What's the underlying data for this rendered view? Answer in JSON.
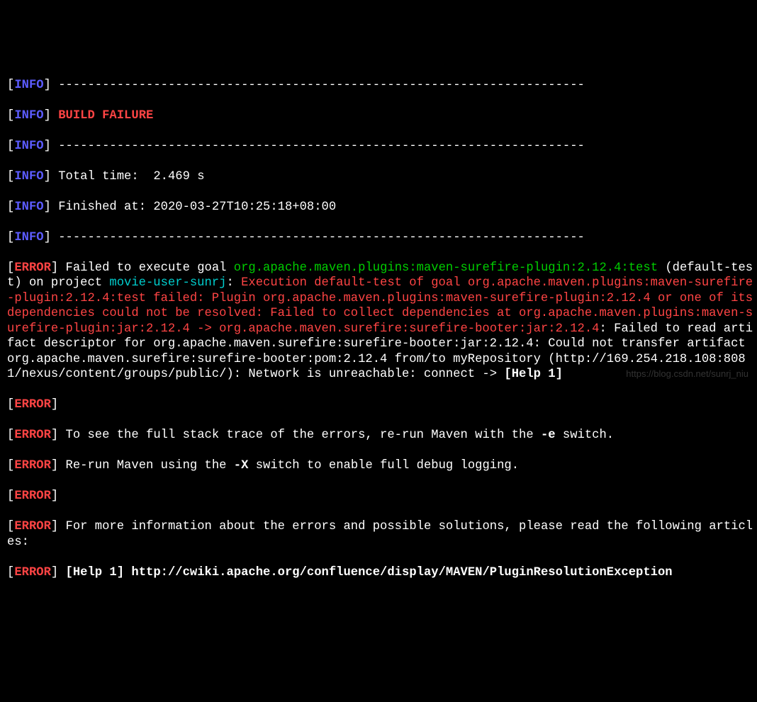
{
  "separator": "------------------------------------------------------------------------",
  "info_label": "INFO",
  "error_label": "ERROR",
  "build_failure": "BUILD FAILURE",
  "total_time": "Total time:  2.469 s",
  "finished_at": "Finished at: 2020-03-27T10:25:18+08:00",
  "error_prefix": "Failed to execute goal ",
  "goal_green": "org.apache.maven.plugins:maven-surefire-plugin:2.12.4:test",
  "default_test": " (default-test) on project ",
  "project_cyan": "movie-user-sunrj",
  "colon": ": ",
  "exec_red": "Execution default-test of goal org.apache.maven.plugins:maven-surefire-plugin:2.12.4:test failed: Plugin org.apache.maven.plugins:maven-surefire-plugin:2.12.4 or one of its dependencies could not be resolved: Failed to collect dependencies at org.apache.maven.plugins:maven-surefire-plugin:jar:2.12.4 -> org.apache.maven.surefire:surefire-booter:jar:2.12.4",
  "tail_white": ": Failed to read artifact descriptor for org.apache.maven.surefire:surefire-booter:jar:2.12.4: Could not transfer artifact org.apache.maven.surefire:surefire-booter:pom:2.12.4 from/to myRepository (http://169.254.218.108:8081/nexus/content/groups/public/): Network is unreachable: connect -> ",
  "help1": "[Help 1]",
  "stack_trace": "To see the full stack trace of the errors, re-run Maven with the ",
  "e_switch": "-e",
  "e_tail": " switch.",
  "rerun": "Re-run Maven using the ",
  "x_switch": "-X",
  "x_tail": " switch to enable full debug logging.",
  "more_info": "For more information about the errors and possible solutions, please read the following articles:",
  "help_link": "[Help 1] http://cwiki.apache.org/confluence/display/MAVEN/PluginResolutionException",
  "watermark": "https://blog.csdn.net/sunrj_niu"
}
